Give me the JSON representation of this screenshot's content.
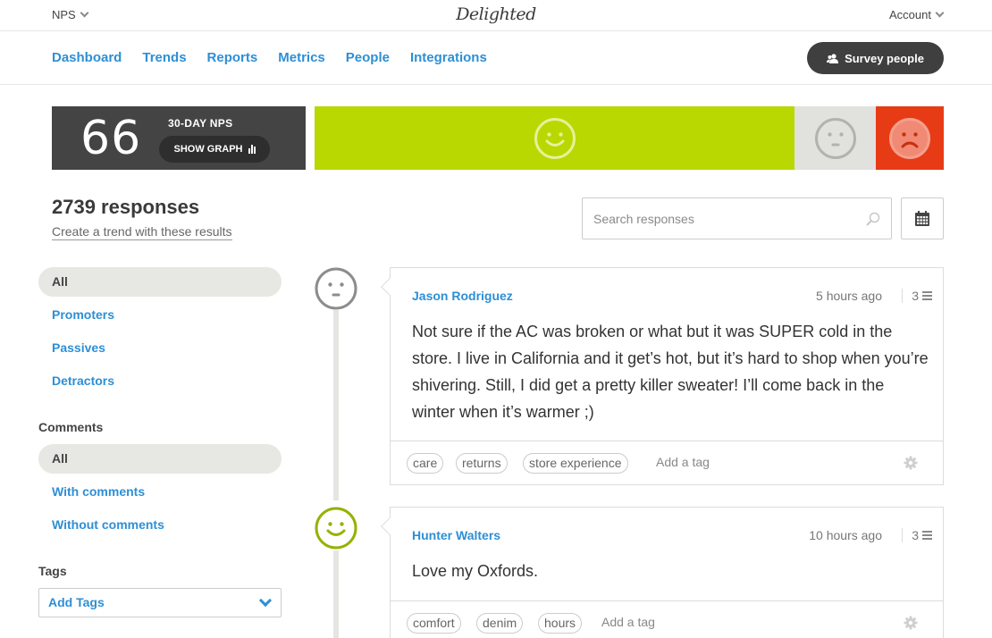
{
  "topbar": {
    "product_label": "NPS",
    "logo_text": "Delighted",
    "account_label": "Account"
  },
  "nav": {
    "items": [
      "Dashboard",
      "Trends",
      "Reports",
      "Metrics",
      "People",
      "Integrations"
    ],
    "survey_button": "Survey people"
  },
  "nps": {
    "score": "66",
    "label": "30-DAY NPS",
    "show_graph": "SHOW GRAPH",
    "distribution": [
      {
        "type": "promoters",
        "share": 0.76,
        "color": "#b9d700"
      },
      {
        "type": "passives",
        "share": 0.13,
        "color": "#e1e1dd"
      },
      {
        "type": "detractors",
        "share": 0.11,
        "color": "#e73b16"
      }
    ]
  },
  "responses": {
    "count_label": "2739 responses",
    "trend_link": "Create a trend with these results",
    "search_placeholder": "Search responses"
  },
  "sidebar": {
    "filters": [
      "All",
      "Promoters",
      "Passives",
      "Detractors"
    ],
    "comments_heading": "Comments",
    "comment_filters": [
      "All",
      "With comments",
      "Without comments"
    ],
    "tags_heading": "Tags",
    "tags_select": "Add Tags"
  },
  "cards": [
    {
      "name": "Jason Rodriguez",
      "time": "5 hours ago",
      "score": "3",
      "mood": "passive",
      "comment": "Not sure if the AC was broken or what but it was SUPER cold in the store. I live in California and it get’s hot, but it’s hard to shop when you’re shivering. Still, I did get a pretty killer sweater! I’ll come back in the winter when it’s warmer ;)",
      "tags": [
        "care",
        "returns",
        "store experience"
      ],
      "add_tag": "Add a tag"
    },
    {
      "name": "Hunter Walters",
      "time": "10 hours ago",
      "score": "3",
      "mood": "promoter",
      "comment": "Love my Oxfords.",
      "tags": [
        "comfort",
        "denim",
        "hours"
      ],
      "add_tag": "Add a tag"
    }
  ]
}
